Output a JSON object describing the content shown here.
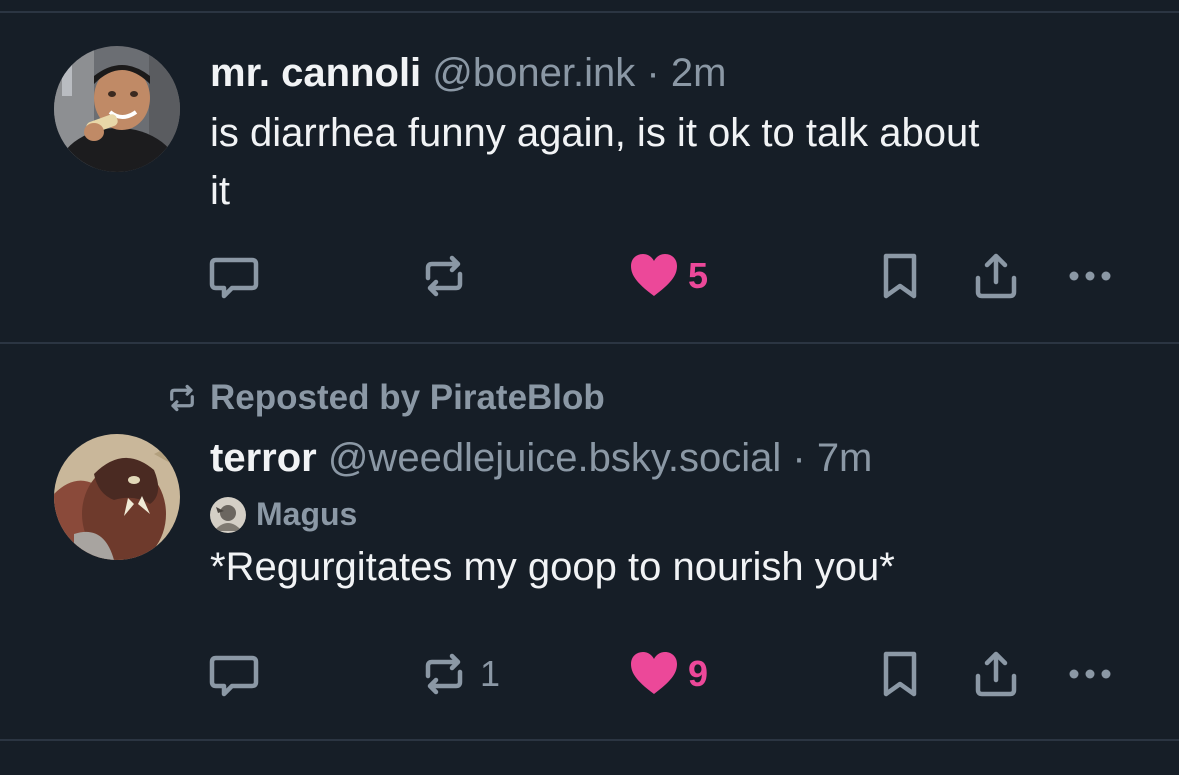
{
  "posts": [
    {
      "display_name": "mr. cannoli",
      "handle": "@boner.ink",
      "separator": "·",
      "time": "2m",
      "text_line1": "is diarrhea funny again, is it ok to talk about",
      "text_line2": "it",
      "avatar": "man-eating-cannoli-photo",
      "reply_count": "",
      "repost_count": "",
      "like_count": "5",
      "liked": true
    },
    {
      "repost_label": "Reposted by PirateBlob",
      "display_name": "terror",
      "handle": "@weedlejuice.bsky.social",
      "separator": "·",
      "time": "7m",
      "feed_name": "Magus",
      "text": "*Regurgitates my goop to nourish you*",
      "avatar": "werewolf-painting",
      "reply_count": "",
      "repost_count": "1",
      "like_count": "9",
      "liked": true
    }
  ],
  "colors": {
    "background": "#161e27",
    "divider": "#2b3542",
    "text": "#f1f3f5",
    "muted": "#8b98a5",
    "like": "#ec4899"
  },
  "icons": [
    "reply-icon",
    "repost-icon",
    "heart-icon",
    "bookmark-icon",
    "share-icon",
    "more-icon"
  ]
}
